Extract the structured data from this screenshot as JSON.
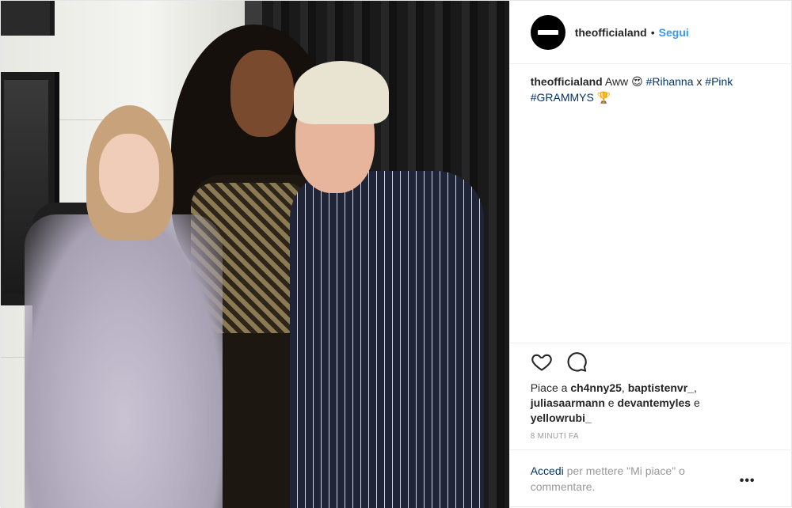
{
  "photo": {
    "alt": ""
  },
  "header": {
    "username": "theofficialand",
    "separator": "•",
    "follow_label": "Segui"
  },
  "caption": {
    "username": "theofficialand",
    "text_before": "Aww",
    "emoji_1": "😍",
    "hashtag_1": "#Rihanna",
    "connector": "x",
    "hashtag_2": "#Pink",
    "hashtag_3": "#GRAMMYS",
    "emoji_2": "🏆"
  },
  "actions": {
    "like_icon": "heart-icon",
    "comment_icon": "comment-icon"
  },
  "likes": {
    "prefix": "Piace a",
    "user_1": "ch4nny25",
    "sep_1": ",",
    "user_2": "baptistenvr_",
    "sep_2": ",",
    "user_3": "juliasaarmann",
    "and_1": "e",
    "user_4": "devantemyles",
    "and_2": "e",
    "user_5": "yellowrubi_"
  },
  "timestamp": "8 MINUTI FA",
  "login_prompt": {
    "link": "Accedi",
    "text": "per mettere \"Mi piace\" o commentare."
  },
  "more_label": "•••",
  "colors": {
    "link_blue": "#3897f0",
    "hashtag_blue": "#003569",
    "text": "#262626",
    "muted": "#999999"
  }
}
